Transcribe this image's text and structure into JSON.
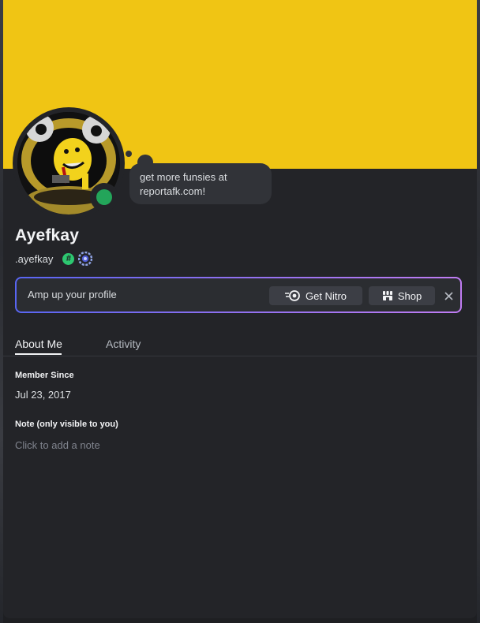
{
  "profile": {
    "bio": "get more funsies at reportafk.com!",
    "display_name": "Ayefkay",
    "username": ".ayefkay",
    "badges": [
      "hashtag-badge-icon",
      "gear-badge-icon"
    ],
    "status": "online",
    "banner_color": "#f0c514"
  },
  "nitro_promo": {
    "text": "Amp up your profile",
    "get_nitro_label": "Get Nitro",
    "shop_label": "Shop"
  },
  "tabs": [
    {
      "label": "About Me",
      "active": true
    },
    {
      "label": "Activity",
      "active": false
    }
  ],
  "about": {
    "member_since_title": "Member Since",
    "member_since_value": "Jul 23, 2017",
    "note_title": "Note (only visible to you)",
    "note_placeholder": "Click to add a note"
  },
  "colors": {
    "status_online": "#23a55a",
    "accent_gradient_start": "#5865f2",
    "accent_gradient_end": "#c07cf3"
  }
}
